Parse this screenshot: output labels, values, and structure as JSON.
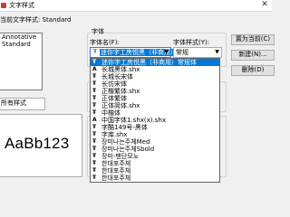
{
  "window": {
    "title": "文字样式"
  },
  "current_style": {
    "label": "当前文字样式:",
    "value": "Standard"
  },
  "styles": {
    "items": [
      "Annotative",
      "Standard"
    ]
  },
  "style_filter": {
    "value": "所有样式"
  },
  "preview": {
    "text": "AaBb123"
  },
  "font": {
    "group_label": "字体",
    "name_label": "字体名(F):",
    "name_value": "迷你字工房悦黑（非商用）",
    "style_label": "字体样式(Y):",
    "style_value": "常规",
    "truetype_icon": "Ŧ"
  },
  "buttons": {
    "set_current": "置为当前(C)",
    "new": "新建(N)...",
    "delete": "删除(D)"
  },
  "font_dropdown": {
    "items": [
      {
        "icon": "Ŧ",
        "name": "迷你字工房悦黑（非商用）常规体",
        "selected": true
      },
      {
        "icon": "A",
        "name": "长城黑体.shx"
      },
      {
        "icon": "Ŧ",
        "name": "长城长宋体"
      },
      {
        "icon": "Ŧ",
        "name": "长仿宋体"
      },
      {
        "icon": "Ŧ",
        "name": "正楷繁体.shx"
      },
      {
        "icon": "Ŧ",
        "name": "正体繁体"
      },
      {
        "icon": "Ŧ",
        "name": "正体简体.shx"
      },
      {
        "icon": "Ŧ",
        "name": "中楷体"
      },
      {
        "icon": "A",
        "name": "中国字体1.shx(x).shx"
      },
      {
        "icon": "Ŧ",
        "name": "字酷149号-黑体"
      },
      {
        "icon": "Ŧ",
        "name": "字库.shx"
      },
      {
        "icon": "Ŧ",
        "name": "장미나는주체Med"
      },
      {
        "icon": "Ŧ",
        "name": "장미나는주체Sbold"
      },
      {
        "icon": "Ŧ",
        "name": "장미-팬단모노"
      },
      {
        "icon": "Ŧ",
        "name": "한대포주체"
      },
      {
        "icon": "Ŧ",
        "name": "한대포주체"
      },
      {
        "icon": "Ŧ",
        "name": "한대포주체"
      }
    ]
  }
}
